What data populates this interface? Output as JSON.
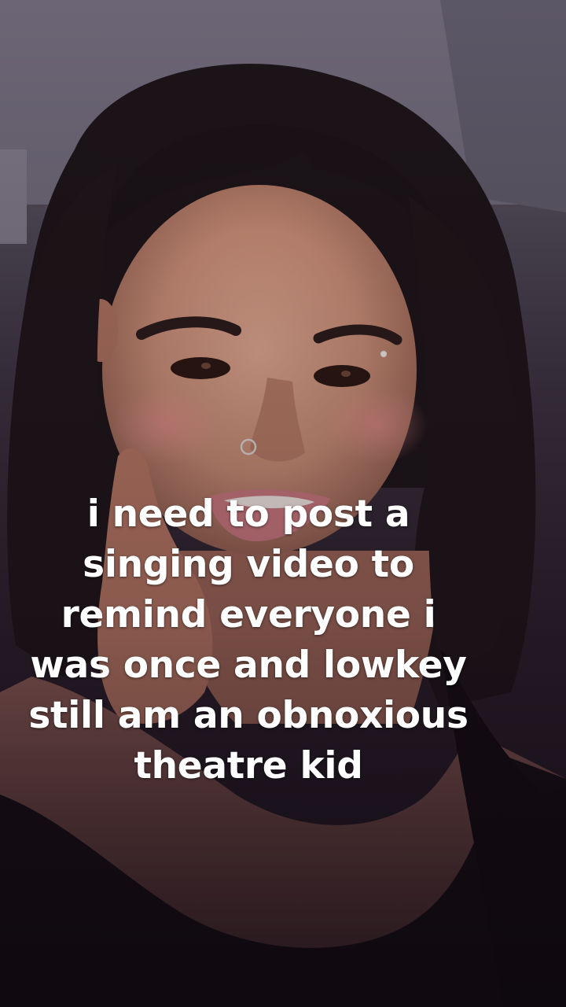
{
  "caption": {
    "lines": [
      "i need to post a",
      "singing video to",
      "remind everyone i",
      "was once and lowkey",
      "still am an obnoxious",
      "theatre kid"
    ]
  },
  "colors": {
    "ceiling": "#6e6878",
    "hair": "#1c1418",
    "skin": "#c98f7a",
    "lips": "#c9787e",
    "top": "#150f15",
    "caption_text": "#ffffff"
  }
}
